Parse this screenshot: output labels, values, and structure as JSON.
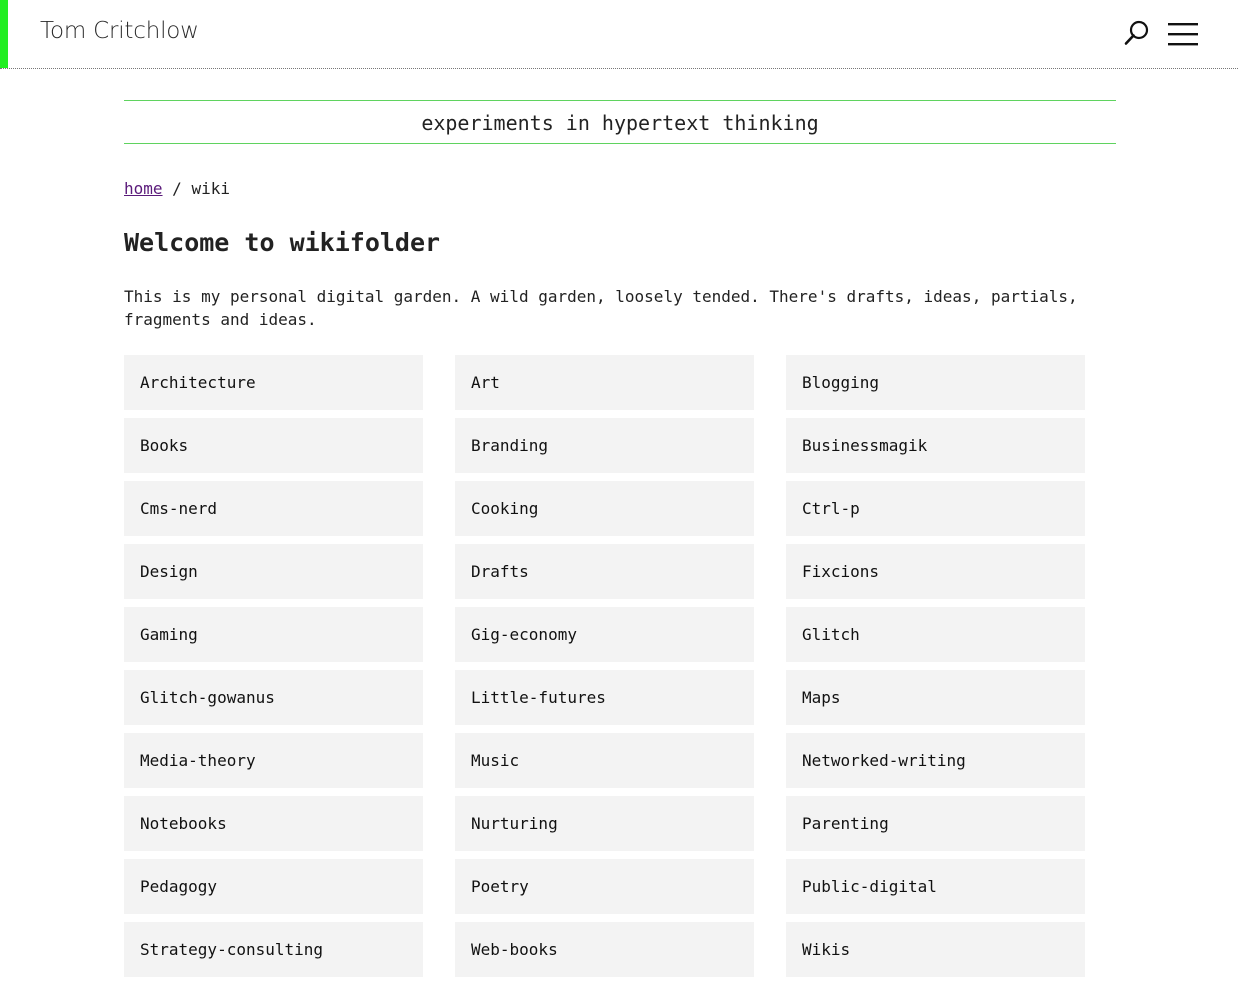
{
  "colors": {
    "accent": "#22ee22",
    "tagline_rule": "#5fd35f",
    "link": "#5a1a7a",
    "card_bg": "#f3f3f3"
  },
  "header": {
    "title": "Tom Critchlow",
    "search_icon": "search-icon",
    "menu_icon": "menu-icon"
  },
  "tagline": "experiments in hypertext thinking",
  "breadcrumb": {
    "home_label": "home",
    "separator": " / ",
    "current": "wiki"
  },
  "page": {
    "title": "Welcome to wikifolder",
    "intro": "This is my personal digital garden. A wild garden, loosely tended. There's drafts, ideas, partials, fragments and ideas."
  },
  "folders": [
    "Architecture",
    "Art",
    "Blogging",
    "Books",
    "Branding",
    "Businessmagik",
    "Cms-nerd",
    "Cooking",
    "Ctrl-p",
    "Design",
    "Drafts",
    "Fixcions",
    "Gaming",
    "Gig-economy",
    "Glitch",
    "Glitch-gowanus",
    "Little-futures",
    "Maps",
    "Media-theory",
    "Music",
    "Networked-writing",
    "Notebooks",
    "Nurturing",
    "Parenting",
    "Pedagogy",
    "Poetry",
    "Public-digital",
    "Strategy-consulting",
    "Web-books",
    "Wikis"
  ]
}
